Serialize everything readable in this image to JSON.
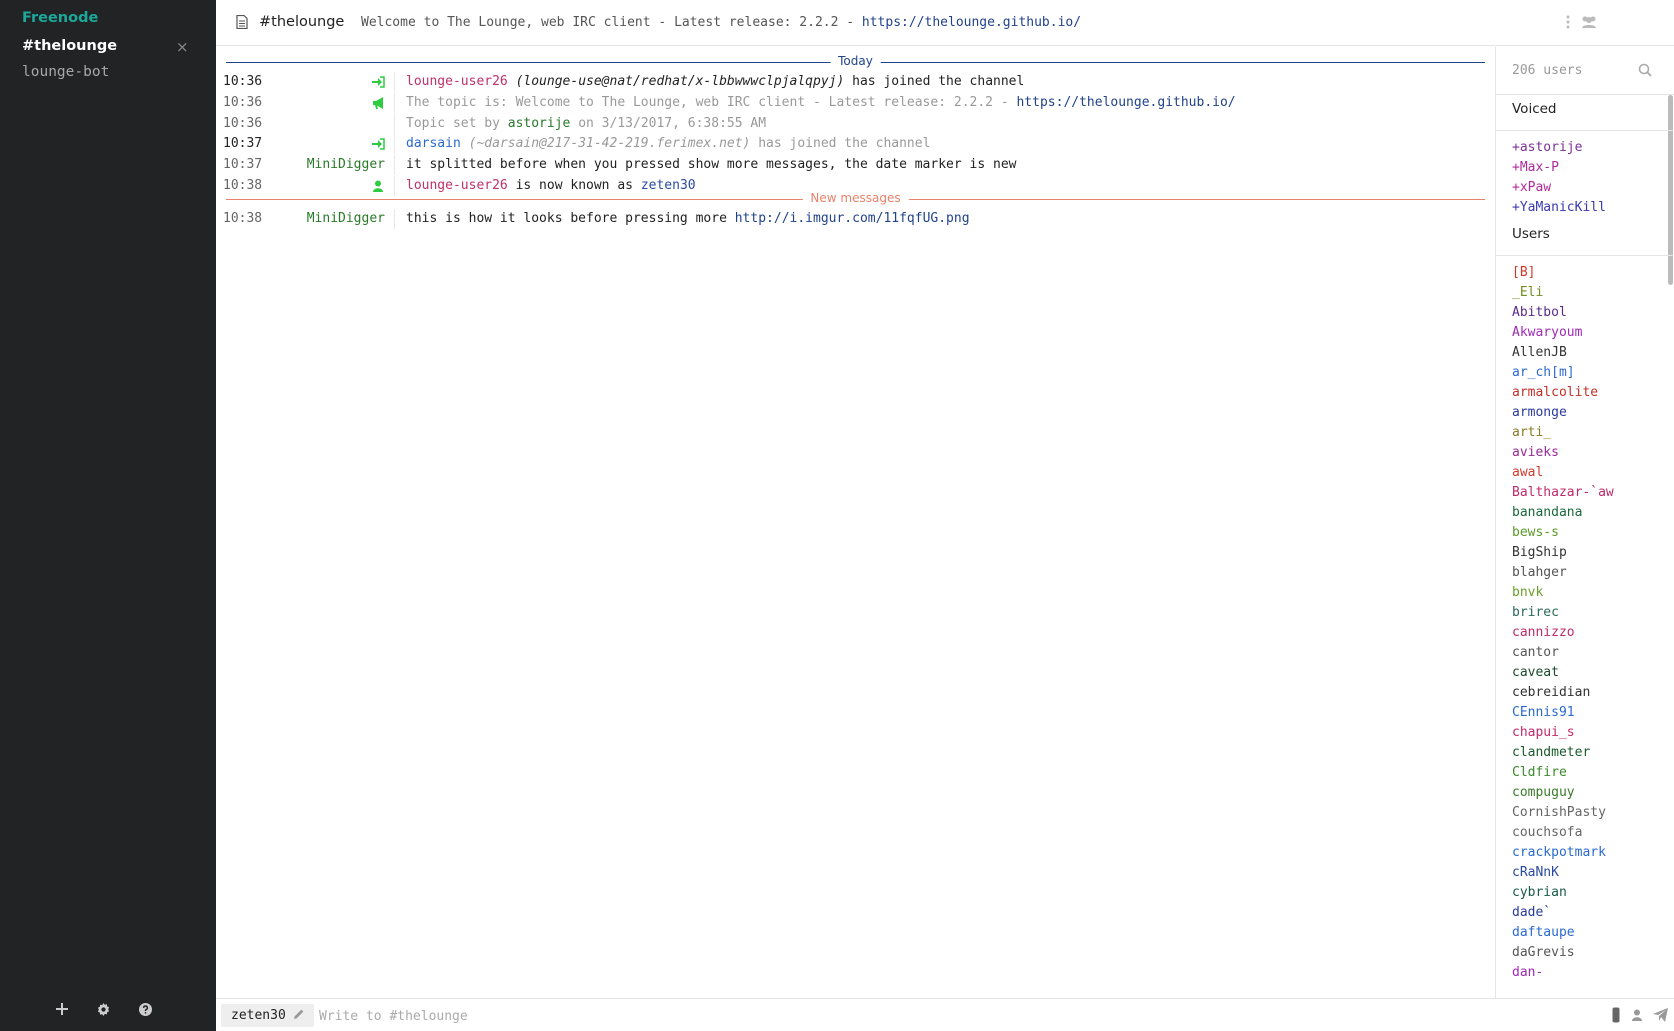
{
  "sidebar": {
    "network": "Freenode",
    "channels": [
      {
        "label": "#thelounge",
        "close": "×"
      },
      {
        "label": "lounge-bot"
      }
    ]
  },
  "header": {
    "title": "#thelounge",
    "topic_text": "Welcome to The Lounge, web IRC client - Latest release: 2.2.2 - ",
    "topic_link": "https://thelounge.github.io/"
  },
  "chat": {
    "date_marker": "Today",
    "unread_marker": "New messages",
    "messages": [
      {
        "time": "10:36",
        "nick": "lounge-user26",
        "host": "(lounge-use@nat/redhat/x-lbbwwwclpjalqpyj)",
        "text": " has joined the channel"
      },
      {
        "time": "10:36",
        "text": "The topic is: Welcome to The Lounge, web IRC client - Latest release: 2.2.2 - ",
        "link": "https://thelounge.github.io/"
      },
      {
        "time": "10:36",
        "text_a": "Topic set by ",
        "nick": "astorije",
        "text_b": " on 3/13/2017, 6:38:55 AM"
      },
      {
        "time": "10:37",
        "nick": "darsain",
        "host": "(~darsain@217-31-42-219.ferimex.net)",
        "text": " has joined the channel"
      },
      {
        "time": "10:37",
        "from": "MiniDigger",
        "text": "it splitted before when you pressed show more messages, the date marker is new"
      },
      {
        "time": "10:38",
        "nick": "lounge-user26",
        "text": " is now known as ",
        "nick2": "zeten30"
      },
      {
        "time": "10:38",
        "from": "MiniDigger",
        "text": "this is how it looks before pressing more ",
        "link": "http://i.imgur.com/11fqfUG.png"
      }
    ]
  },
  "users_panel": {
    "count": "206 users",
    "voiced_label": "Voiced",
    "users_label": "Users",
    "voiced": [
      {
        "name": "+astorije",
        "color": "#7a3295"
      },
      {
        "name": "+Max-P",
        "color": "#b02a9b"
      },
      {
        "name": "+xPaw",
        "color": "#b02a9b"
      },
      {
        "name": "+YaManicKill",
        "color": "#3a3ab0"
      }
    ],
    "users": [
      {
        "name": "[B]",
        "color": "#d03a2a"
      },
      {
        "name": "_Eli",
        "color": "#6f8f20"
      },
      {
        "name": "Abitbol",
        "color": "#5a2a8a"
      },
      {
        "name": "Akwaryoum",
        "color": "#a02ab5"
      },
      {
        "name": "AllenJB",
        "color": "#333333"
      },
      {
        "name": "ar_ch[m]",
        "color": "#2a6ad0"
      },
      {
        "name": "armalcolite",
        "color": "#c0302a"
      },
      {
        "name": "armonge",
        "color": "#2a3a9a"
      },
      {
        "name": "arti_",
        "color": "#8a7a20"
      },
      {
        "name": "avieks",
        "color": "#9a2a9a"
      },
      {
        "name": "awal",
        "color": "#d03a2a"
      },
      {
        "name": "Balthazar-`aw",
        "color": "#c02a6a"
      },
      {
        "name": "banandana",
        "color": "#1a6a3a"
      },
      {
        "name": "bews-s",
        "color": "#5a9a2a"
      },
      {
        "name": "BigShip",
        "color": "#333333"
      },
      {
        "name": "blahger",
        "color": "#555555"
      },
      {
        "name": "bnvk",
        "color": "#6aa02a"
      },
      {
        "name": "brirec",
        "color": "#2a6a5a"
      },
      {
        "name": "cannizzo",
        "color": "#c02a6a"
      },
      {
        "name": "cantor",
        "color": "#555555"
      },
      {
        "name": "caveat",
        "color": "#1a4a2a"
      },
      {
        "name": "cebreidian",
        "color": "#333333"
      },
      {
        "name": "CEnnis91",
        "color": "#2a6ad0"
      },
      {
        "name": "chapui_s",
        "color": "#c02a6a"
      },
      {
        "name": "clandmeter",
        "color": "#1a5a2a"
      },
      {
        "name": "Cldfire",
        "color": "#3a8a2a"
      },
      {
        "name": "compuguy",
        "color": "#3a7a2a"
      },
      {
        "name": "CornishPasty",
        "color": "#666666"
      },
      {
        "name": "couchsofa",
        "color": "#666666"
      },
      {
        "name": "crackpotmark",
        "color": "#2a6ad0"
      },
      {
        "name": "cRaNnK",
        "color": "#2a4aa0"
      },
      {
        "name": "cybrian",
        "color": "#1a5a4a"
      },
      {
        "name": "dade`",
        "color": "#2a3a9a"
      },
      {
        "name": "daftaupe",
        "color": "#2a6ad0"
      },
      {
        "name": "daGrevis",
        "color": "#555555"
      },
      {
        "name": "dan-",
        "color": "#a02ab5"
      }
    ]
  },
  "footer": {
    "nick": "zeten30",
    "placeholder": "Write to #thelounge"
  },
  "icons": [
    "plus-icon",
    "gear-icon",
    "help-icon",
    "document-icon",
    "menu-dots-icon",
    "users-icon",
    "search-icon",
    "join-icon",
    "megaphone-icon",
    "nick-change-icon",
    "pencil-icon",
    "upload-icon",
    "user-icon",
    "send-icon"
  ],
  "colors": {
    "sidebar_bg": "#222325",
    "accent": "#1aa99a",
    "link": "#22438a",
    "join_green": "#2ecc40",
    "nick_pink": "#c0306a",
    "nick_green": "#2a7a2a",
    "date_line": "#22438a",
    "unread_line": "#e8826a"
  }
}
